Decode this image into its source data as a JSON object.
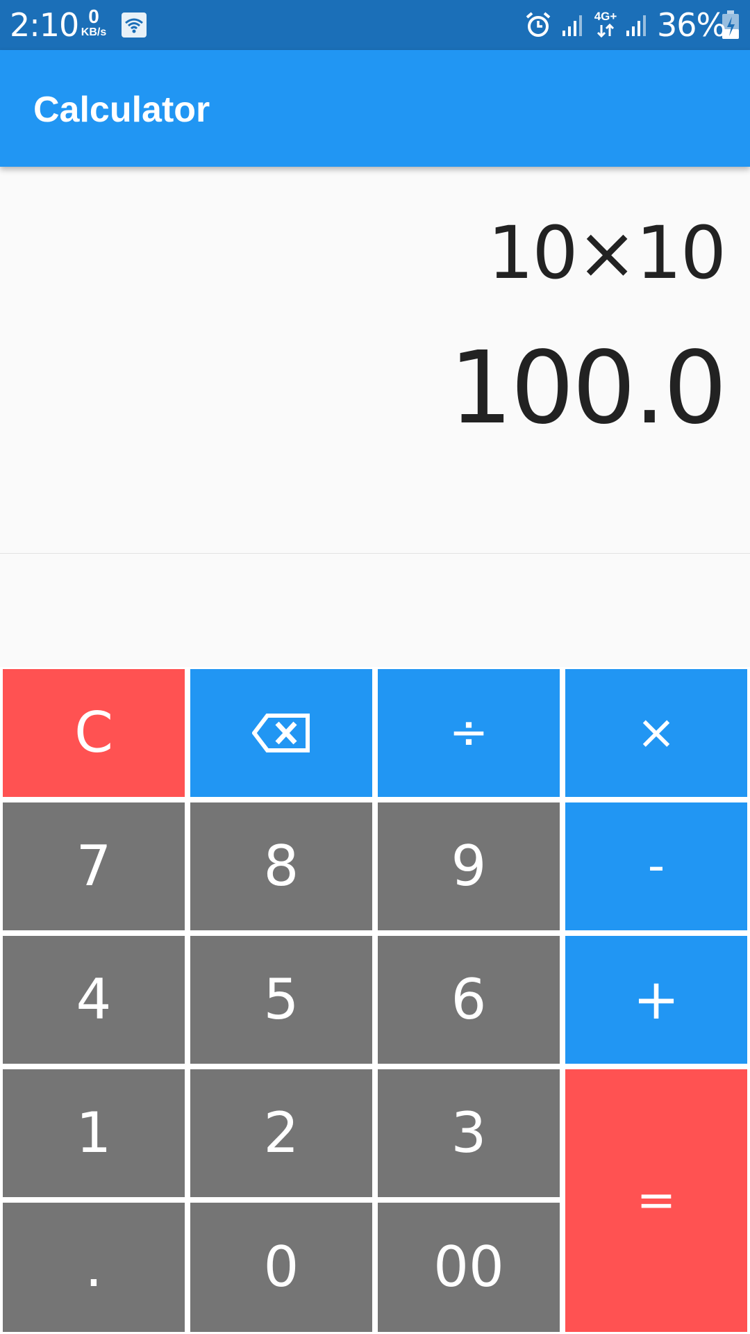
{
  "status_bar": {
    "time": "2:10",
    "data_rate_value": "0",
    "data_rate_unit": "KB/s",
    "network_type": "4G+",
    "battery_percent": "36%",
    "icons": [
      "wifi-icon",
      "alarm-icon",
      "signal-icon",
      "battery-charging-icon"
    ]
  },
  "app_bar": {
    "title": "Calculator"
  },
  "display": {
    "expression": "10×10",
    "result": "100.0"
  },
  "keypad": {
    "keys": [
      {
        "label": "C",
        "color": "#ff5252"
      },
      {
        "label": "",
        "icon": "backspace-icon",
        "color": "#2196f3"
      },
      {
        "label": "÷",
        "color": "#2196f3"
      },
      {
        "label": "×",
        "color": "#2196f3"
      },
      {
        "label": "7",
        "color": "#757575"
      },
      {
        "label": "8",
        "color": "#757575"
      },
      {
        "label": "9",
        "color": "#757575"
      },
      {
        "label": "-",
        "color": "#2196f3"
      },
      {
        "label": "4",
        "color": "#757575"
      },
      {
        "label": "5",
        "color": "#757575"
      },
      {
        "label": "6",
        "color": "#757575"
      },
      {
        "label": "+",
        "color": "#2196f3"
      },
      {
        "label": "1",
        "color": "#757575"
      },
      {
        "label": "2",
        "color": "#757575"
      },
      {
        "label": "3",
        "color": "#757575"
      },
      {
        "label": "=",
        "color": "#ff5252"
      },
      {
        "label": ".",
        "color": "#757575"
      },
      {
        "label": "0",
        "color": "#757575"
      },
      {
        "label": "00",
        "color": "#757575"
      }
    ]
  },
  "colors": {
    "primary": "#2196f3",
    "status_bar": "#1b6fb8",
    "accent_red": "#ff5252",
    "digit_gray": "#757575"
  }
}
